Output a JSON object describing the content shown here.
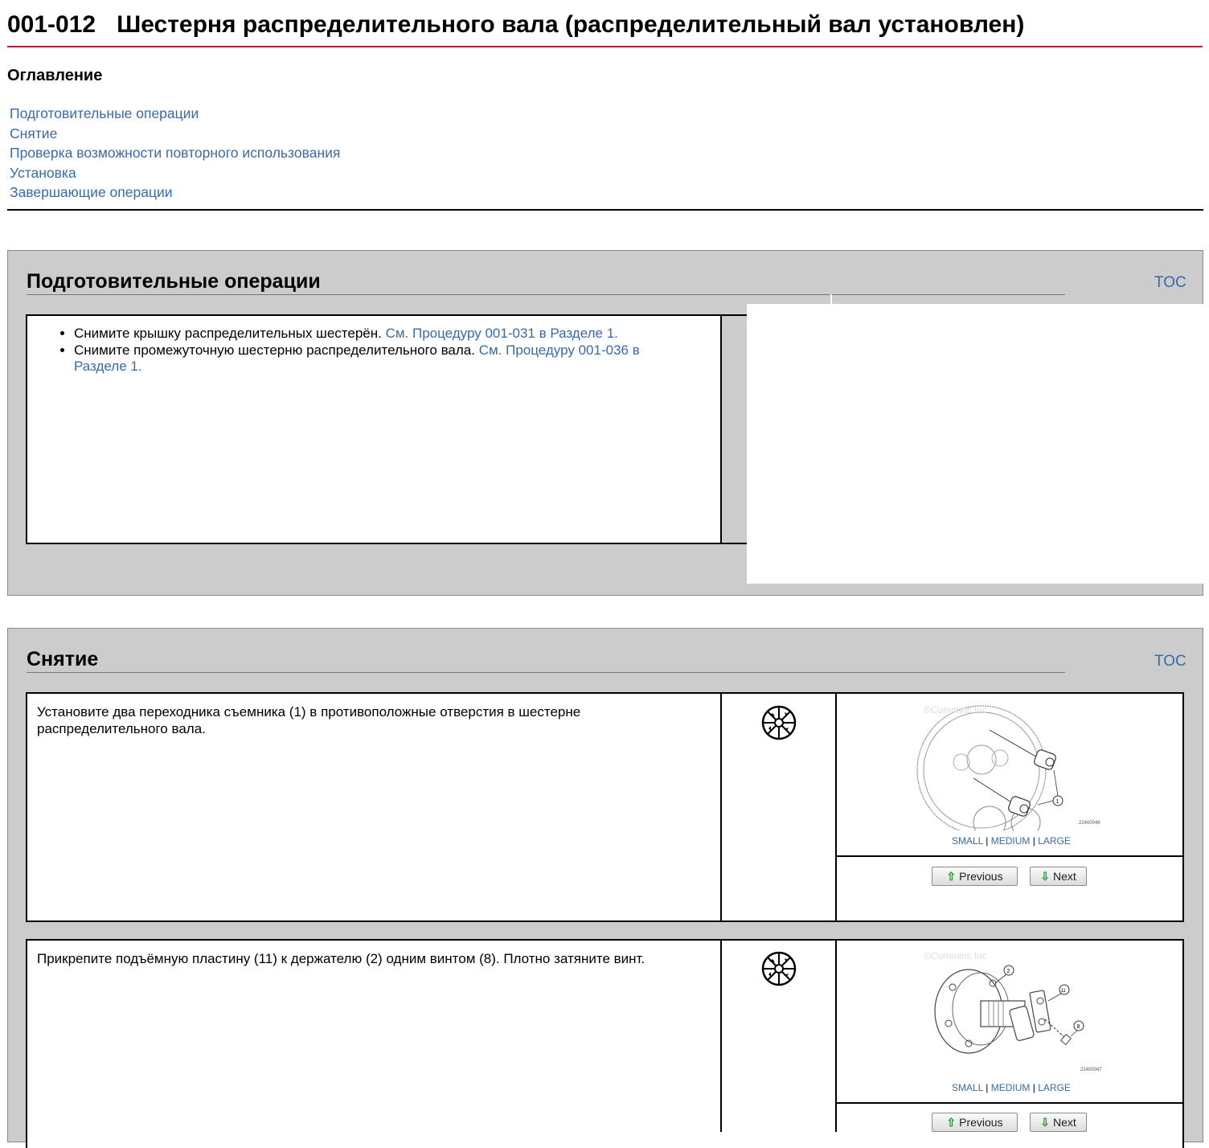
{
  "header": {
    "code": "001-012",
    "title": "Шестерня распределительного вала (распределительный вал установлен)"
  },
  "toc": {
    "heading": "Оглавление",
    "items": [
      "Подготовительные операции",
      "Снятие",
      "Проверка возможности повторного использования",
      "Установка",
      "Завершающие операции"
    ]
  },
  "sections": [
    {
      "title": "Подготовительные операции",
      "toc_link": "TOC",
      "bullets": [
        {
          "text": "Снимите крышку распределительных шестерён. ",
          "link": "См. Процедуру 001-031 в Разделе 1."
        },
        {
          "text": "Снимите промежуточную шестерню распределительного вала. ",
          "link": "См. Процедуру 001-036 в Разделе 1."
        }
      ]
    },
    {
      "title": "Снятие",
      "toc_link": "TOC",
      "steps": [
        {
          "text": "Установите два переходника съемника (1) в противоположные отверстия в шестерне распределительного вала.",
          "watermark": "©Cummins Inc",
          "image_number": "22400046",
          "size_links": [
            "SMALL",
            "MEDIUM",
            "LARGE"
          ],
          "prev_label": "Previous",
          "next_label": "Next"
        },
        {
          "text": "Прикрепите подъёмную пластину (11) к держателю (2) одним винтом (8). Плотно затяните винт.",
          "watermark": "©Cummins Inc",
          "image_number": "22400047",
          "size_links": [
            "SMALL",
            "MEDIUM",
            "LARGE"
          ],
          "prev_label": "Previous",
          "next_label": "Next"
        }
      ]
    }
  ],
  "icons": {
    "tool": "tool-wheel-icon",
    "arrow_up": "green-up-arrow-icon",
    "arrow_down": "green-down-arrow-icon"
  },
  "colors": {
    "title_rule": "#c8102e",
    "link": "#3a6aa5",
    "section_bg": "#cccccc"
  }
}
